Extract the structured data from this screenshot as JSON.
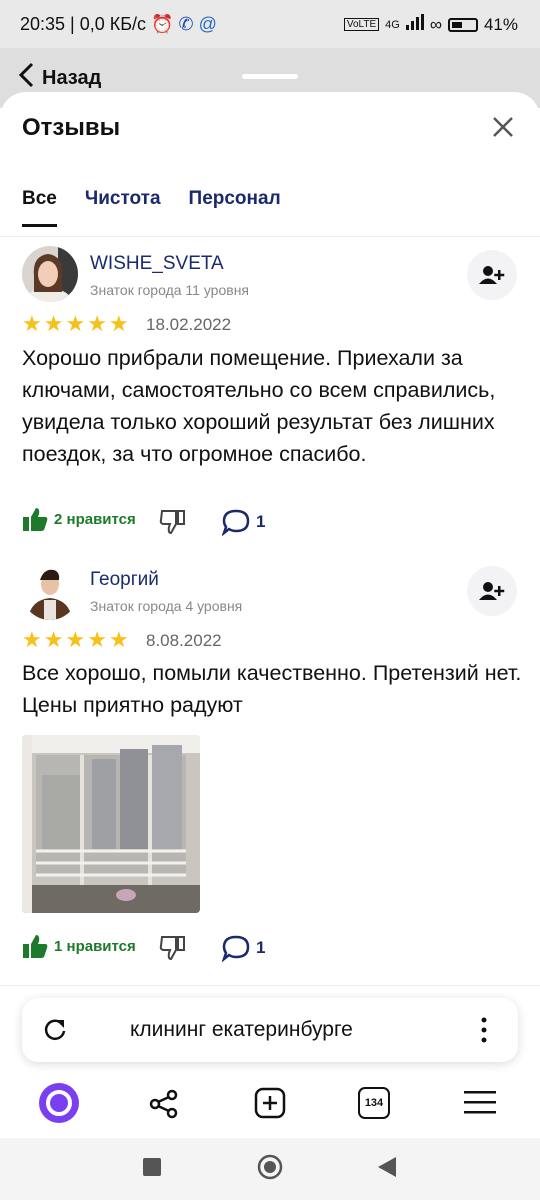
{
  "status_bar": {
    "time_and_net": "20:35 | 0,0 КБ/с",
    "net_type": "4G",
    "battery": "41%"
  },
  "background_nav": {
    "back_label": "Назад"
  },
  "sheet": {
    "title": "Отзывы"
  },
  "tabs": [
    {
      "label": "Все",
      "active": true
    },
    {
      "label": "Чистота",
      "active": false
    },
    {
      "label": "Персонал",
      "active": false
    }
  ],
  "reviews": [
    {
      "author": "WISHE_SVETA",
      "level": "Знаток города 11 уровня",
      "rating": 5,
      "date": "18.02.2022",
      "text": "Хорошо прибрали помещение. Приехали за ключами, самостоятельно со всем справились, увидела только хороший результат без лишних поездок, за что огромное спасибо.",
      "likes": "2 нравится",
      "comments": "1"
    },
    {
      "author": "Георгий",
      "level": "Знаток города 4 уровня",
      "rating": 5,
      "date": "8.08.2022",
      "text": "Все хорошо, помыли качественно. Претензий нет. Цены приятно радуют",
      "likes": "1 нравится",
      "comments": "1"
    }
  ],
  "search_bar": {
    "query": "клининг екатеринбурге"
  },
  "browser_toolbar": {
    "tabs_count": "134"
  },
  "colors": {
    "accent": "#1b2a6b",
    "star": "#f6c11a",
    "like": "#1d7a2a",
    "alice": "#7b3ff2"
  }
}
